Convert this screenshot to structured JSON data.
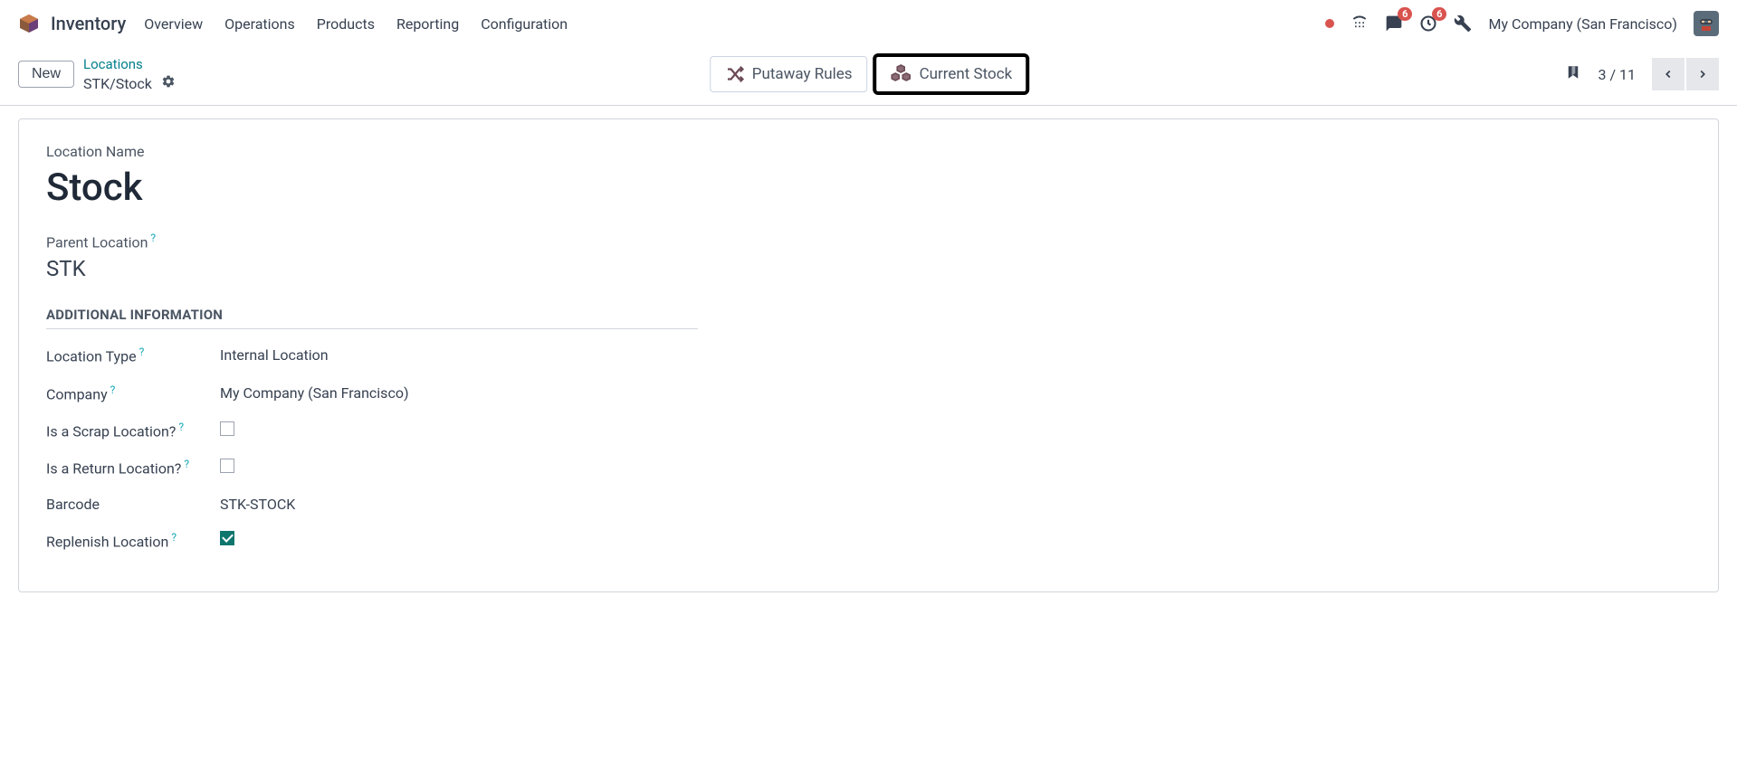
{
  "nav": {
    "app": "Inventory",
    "items": [
      "Overview",
      "Operations",
      "Products",
      "Reporting",
      "Configuration"
    ],
    "company": "My Company (San Francisco)",
    "badge_messages": "6",
    "badge_activities": "6"
  },
  "controlbar": {
    "new_label": "New",
    "breadcrumb_parent": "Locations",
    "breadcrumb_current": "STK/Stock",
    "buttons": {
      "putaway": "Putaway Rules",
      "current_stock": "Current Stock"
    },
    "pager": "3 / 11"
  },
  "form": {
    "location_name_label": "Location Name",
    "location_name_value": "Stock",
    "parent_location_label": "Parent Location",
    "parent_location_value": "STK",
    "section_additional": "ADDITIONAL INFORMATION",
    "location_type_label": "Location Type",
    "location_type_value": "Internal Location",
    "company_label": "Company",
    "company_value": "My Company (San Francisco)",
    "scrap_label": "Is a Scrap Location?",
    "return_label": "Is a Return Location?",
    "barcode_label": "Barcode",
    "barcode_value": "STK-STOCK",
    "replenish_label": "Replenish Location",
    "help_marker": "?"
  }
}
